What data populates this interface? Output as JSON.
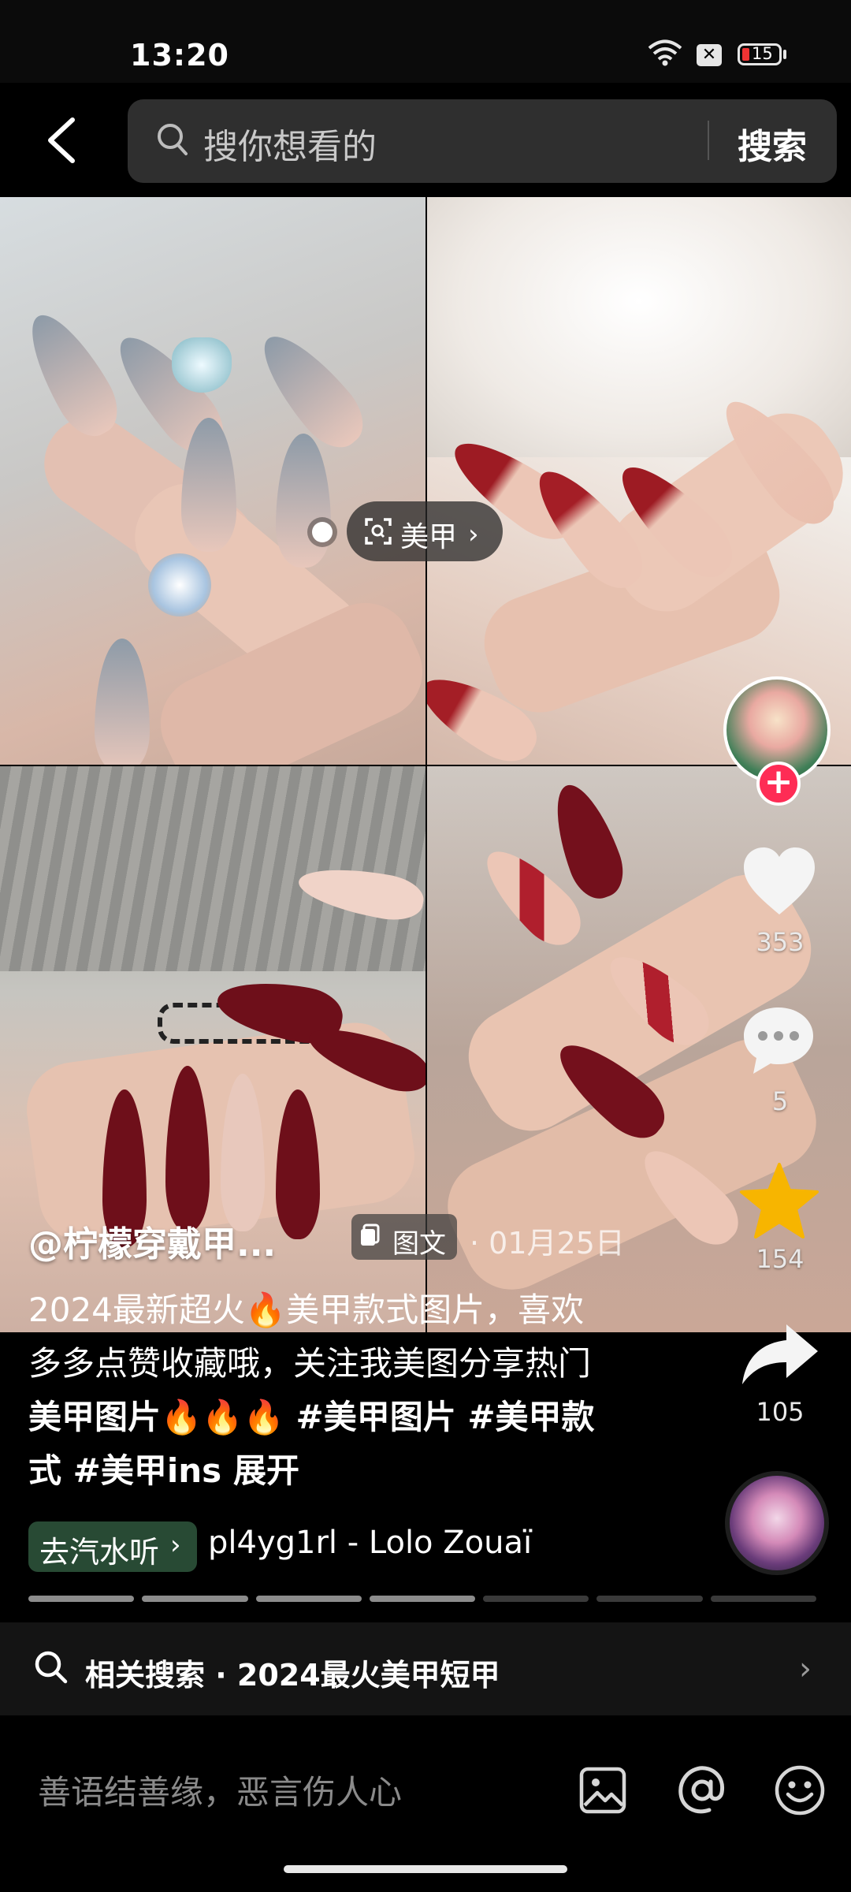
{
  "status_bar": {
    "time": "13:20",
    "battery": "15"
  },
  "search": {
    "placeholder": "搜你想看的",
    "button": "搜索"
  },
  "image_tag": {
    "label": "美甲"
  },
  "rail": {
    "likes": "353",
    "comments": "5",
    "favorites": "154",
    "shares": "105"
  },
  "post": {
    "author": "@柠檬穿戴甲...",
    "type_badge": "图文",
    "date": "· 01月25日",
    "caption_lines": [
      "2024最新超火🔥美甲款式图片，喜欢",
      "多多点赞收藏哦，关注我美图分享热门",
      "美甲图片🔥🔥🔥 #美甲图片 #美甲款",
      "式 #美甲ins"
    ],
    "expand": "展开",
    "music_pill": "去汽水听",
    "music_title": "pl4yg1rl - Lolo Zouaï",
    "image_count": 7,
    "image_index": 4
  },
  "related": {
    "label": "相关搜索 · 2024最火美甲短甲"
  },
  "comment": {
    "placeholder": "善语结善缘，恶言伤人心"
  },
  "colors": {
    "accent_red": "#fe2c55",
    "star": "#f7b500",
    "music_green": "#284a34"
  }
}
